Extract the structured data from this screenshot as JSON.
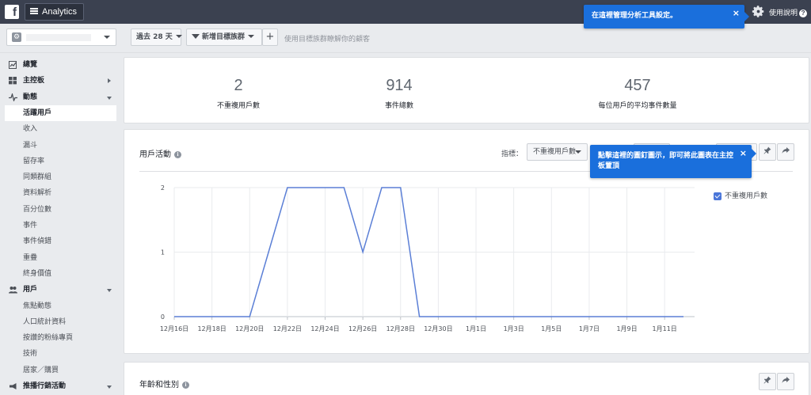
{
  "topbar": {
    "logo": "f",
    "app_name": "Analytics",
    "help_label": "使用說明",
    "help_glyph": "?"
  },
  "tooltips": {
    "settings_tip": "在這裡管理分析工具設定。",
    "pin_tip": "點擊這裡的圖釘圖示，即可將此圖表在主控板置頂",
    "close_glyph": "×"
  },
  "app_selector": {
    "icon_glyph": "⚙"
  },
  "toolbar": {
    "range_label": "過去 28 天",
    "segment_label": "新增目標族群",
    "add_glyph": "+",
    "segment_hint": "使用目標族群瞭解你的顧客"
  },
  "sidebar": {
    "items": [
      {
        "label": "總覽",
        "type": "sec",
        "icon": "chart-check-icon"
      },
      {
        "label": "主控板",
        "type": "sec",
        "icon": "grid-icon",
        "arrow": "right"
      },
      {
        "label": "動態",
        "type": "sec",
        "icon": "activity-icon",
        "arrow": "down"
      },
      {
        "label": "活躍用戶",
        "type": "active"
      },
      {
        "label": "收入",
        "type": "sub"
      },
      {
        "label": "漏斗",
        "type": "sub"
      },
      {
        "label": "留存率",
        "type": "sub"
      },
      {
        "label": "同類群組",
        "type": "sub"
      },
      {
        "label": "資料解析",
        "type": "sub"
      },
      {
        "label": "百分位數",
        "type": "sub"
      },
      {
        "label": "事件",
        "type": "sub"
      },
      {
        "label": "事件偵錯",
        "type": "sub"
      },
      {
        "label": "重疊",
        "type": "sub"
      },
      {
        "label": "終身價值",
        "type": "sub"
      },
      {
        "label": "用戶",
        "type": "sec",
        "icon": "people-icon",
        "arrow": "down"
      },
      {
        "label": "焦點動態",
        "type": "sub"
      },
      {
        "label": "人口統計資料",
        "type": "sub"
      },
      {
        "label": "按讚的粉絲專頁",
        "type": "sub"
      },
      {
        "label": "技術",
        "type": "sub"
      },
      {
        "label": "居家／購買",
        "type": "sub"
      },
      {
        "label": "推播行銷活動",
        "type": "sec",
        "icon": "megaphone-icon",
        "arrow": "down"
      }
    ]
  },
  "summary": {
    "stats": [
      {
        "value": "2",
        "label": "不重複用戶數"
      },
      {
        "value": "914",
        "label": "事件總數"
      },
      {
        "value": "457",
        "label": "每位用戶的平均事件數量"
      }
    ]
  },
  "activity_card": {
    "title": "用戶活動",
    "info_glyph": "i",
    "metric_label": "指標：",
    "metric_value": "不重複用戶數",
    "pin_glyph": "📌",
    "share_glyph": "➦"
  },
  "age_card": {
    "title": "年齡和性別",
    "info_glyph": "i"
  },
  "chart_data": {
    "type": "line",
    "x": [
      "12月16日",
      "12月17日",
      "12月18日",
      "12月19日",
      "12月20日",
      "12月21日",
      "12月22日",
      "12月23日",
      "12月24日",
      "12月25日",
      "12月26日",
      "12月27日",
      "12月28日",
      "12月29日",
      "12月30日",
      "12月31日",
      "1月1日",
      "1月2日",
      "1月3日",
      "1月4日",
      "1月5日",
      "1月6日",
      "1月7日",
      "1月8日",
      "1月9日",
      "1月10日",
      "1月11日",
      "1月12日"
    ],
    "x_tick_labels": [
      "12月16日",
      "12月18日",
      "12月20日",
      "12月22日",
      "12月24日",
      "12月26日",
      "12月28日",
      "12月30日",
      "1月1日",
      "1月3日",
      "1月5日",
      "1月7日",
      "1月9日",
      "1月11日"
    ],
    "series": [
      {
        "name": "不重複用戶數",
        "color": "#5b7fd6",
        "values": [
          0,
          0,
          0,
          0,
          0,
          1,
          2,
          2,
          2,
          2,
          1,
          2,
          2,
          0,
          0,
          0,
          0,
          0,
          0,
          0,
          0,
          0,
          0,
          0,
          0,
          0,
          0,
          0
        ]
      }
    ],
    "y_ticks": [
      "0",
      "1",
      "2"
    ],
    "ylim": [
      0,
      2
    ],
    "grid": true,
    "legend": "right"
  }
}
